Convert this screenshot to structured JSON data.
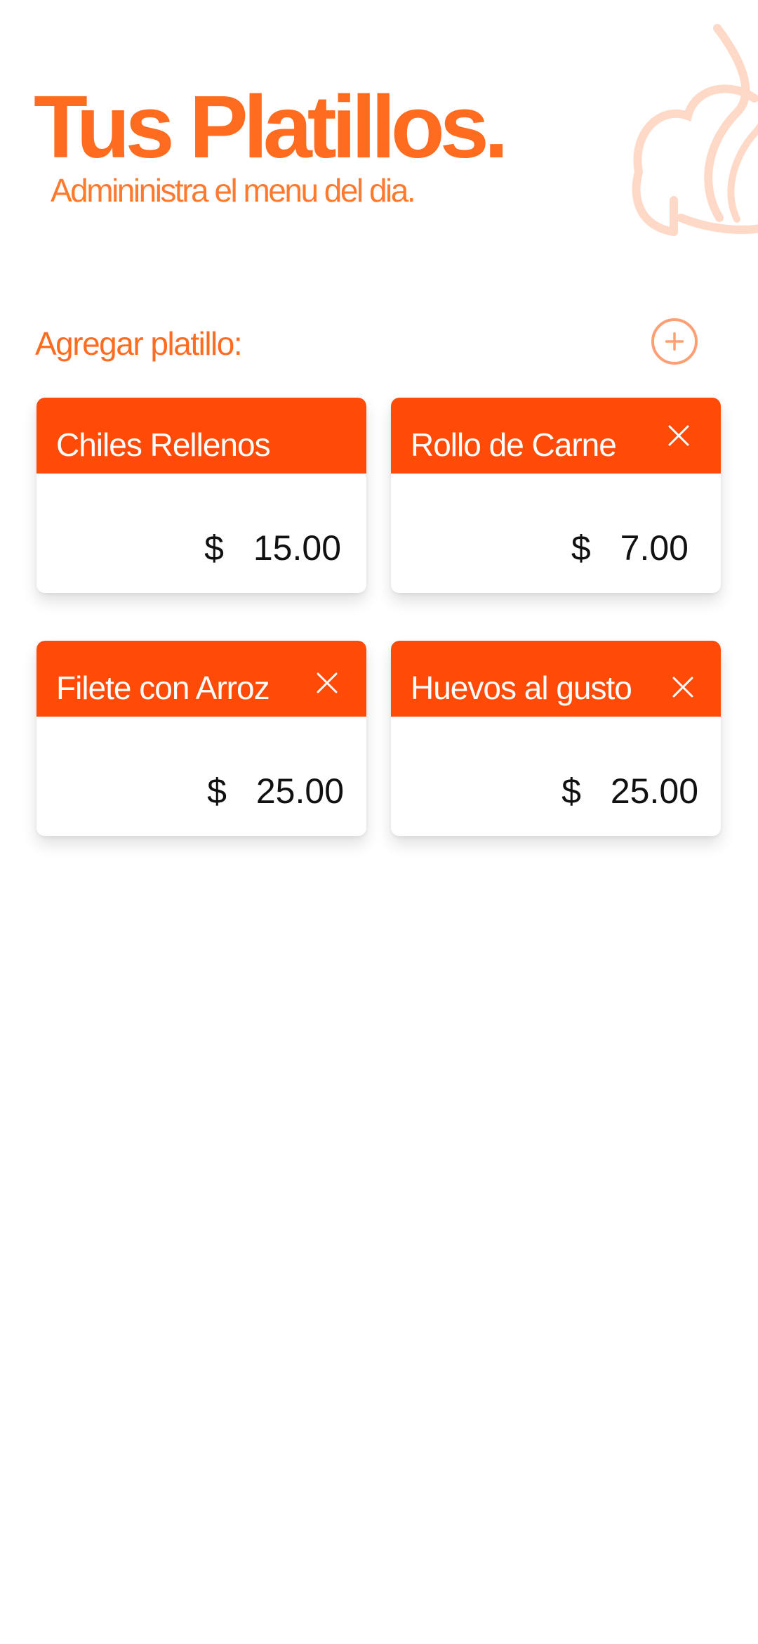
{
  "header": {
    "title": "Tus Platillos.",
    "subtitle": "Admininistra el menu del dia."
  },
  "add_section": {
    "label": "Agregar platillo:",
    "add_icon": "plus-circle-icon"
  },
  "colors": {
    "accent": "#ff6b1f",
    "card_header": "#ff4a08",
    "logo": "#ffd9c8"
  },
  "dishes": [
    {
      "name": "Chiles Rellenos",
      "currency": "$",
      "price": "15.00",
      "has_close": false
    },
    {
      "name": "Rollo de Carne",
      "currency": "$",
      "price": "7.00",
      "has_close": true
    },
    {
      "name": "Filete con Arroz",
      "currency": "$",
      "price": "25.00",
      "has_close": true
    },
    {
      "name": "Huevos al gusto",
      "currency": "$",
      "price": "25.00",
      "has_close": true
    }
  ]
}
